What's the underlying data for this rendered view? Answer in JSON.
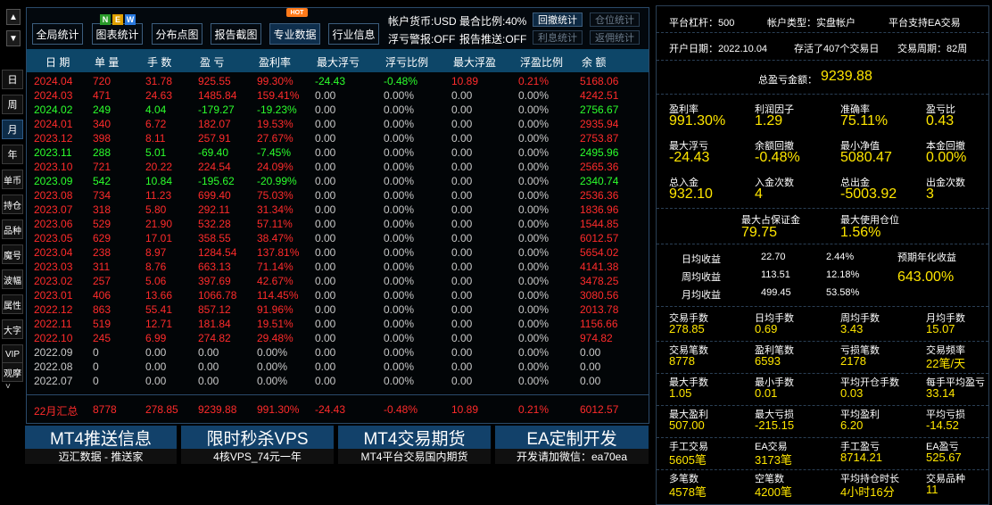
{
  "nav": {
    "up_arrow": "▲",
    "down_arrow": "▼",
    "left_tabs": [
      "日",
      "周",
      "月",
      "年",
      "单币",
      "持仓",
      "品种",
      "魔号",
      "波幅",
      "属性",
      "大字",
      "VIP",
      "观摩"
    ],
    "more_chevron": "˅"
  },
  "toolbar": {
    "buttons": [
      "全局统计",
      "图表统计",
      "分布点图",
      "报告截图",
      "专业数据",
      "行业信息"
    ],
    "new_badge": [
      "N",
      "E",
      "W"
    ],
    "hot_badge": "HOT",
    "account_currency": "帐户货币:USD",
    "max_ratio": "最合比例:40%",
    "floating_alert": "浮亏警报:OFF",
    "report_push": "报告推送:OFF",
    "small_buttons": [
      "回撤统计",
      "仓位统计",
      "利息统计",
      "返佣统计"
    ]
  },
  "table": {
    "headers": [
      "日 期",
      "单 量",
      "手 数",
      "盈 亏",
      "盈利率",
      "最大浮亏",
      "浮亏比例",
      "最大浮盈",
      "浮盈比例",
      "余 额"
    ],
    "rows": [
      {
        "date": "2024.04",
        "orders": "720",
        "lots": "31.78",
        "pnl": "925.55",
        "rate": "99.30%",
        "max_dd": "-24.43",
        "dd_ratio": "-0.48%",
        "max_fp": "10.89",
        "fp_ratio": "0.21%",
        "balance": "5168.06",
        "color": "red"
      },
      {
        "date": "2024.03",
        "orders": "471",
        "lots": "24.63",
        "pnl": "1485.84",
        "rate": "159.41%",
        "max_dd": "0.00",
        "dd_ratio": "0.00%",
        "max_fp": "0.00",
        "fp_ratio": "0.00%",
        "balance": "4242.51",
        "color": "red"
      },
      {
        "date": "2024.02",
        "orders": "249",
        "lots": "4.04",
        "pnl": "-179.27",
        "rate": "-19.23%",
        "max_dd": "0.00",
        "dd_ratio": "0.00%",
        "max_fp": "0.00",
        "fp_ratio": "0.00%",
        "balance": "2756.67",
        "color": "green"
      },
      {
        "date": "2024.01",
        "orders": "340",
        "lots": "6.72",
        "pnl": "182.07",
        "rate": "19.53%",
        "max_dd": "0.00",
        "dd_ratio": "0.00%",
        "max_fp": "0.00",
        "fp_ratio": "0.00%",
        "balance": "2935.94",
        "color": "red"
      },
      {
        "date": "2023.12",
        "orders": "398",
        "lots": "8.11",
        "pnl": "257.91",
        "rate": "27.67%",
        "max_dd": "0.00",
        "dd_ratio": "0.00%",
        "max_fp": "0.00",
        "fp_ratio": "0.00%",
        "balance": "2753.87",
        "color": "red"
      },
      {
        "date": "2023.11",
        "orders": "288",
        "lots": "5.01",
        "pnl": "-69.40",
        "rate": "-7.45%",
        "max_dd": "0.00",
        "dd_ratio": "0.00%",
        "max_fp": "0.00",
        "fp_ratio": "0.00%",
        "balance": "2495.96",
        "color": "green"
      },
      {
        "date": "2023.10",
        "orders": "721",
        "lots": "20.22",
        "pnl": "224.54",
        "rate": "24.09%",
        "max_dd": "0.00",
        "dd_ratio": "0.00%",
        "max_fp": "0.00",
        "fp_ratio": "0.00%",
        "balance": "2565.36",
        "color": "red"
      },
      {
        "date": "2023.09",
        "orders": "542",
        "lots": "10.84",
        "pnl": "-195.62",
        "rate": "-20.99%",
        "max_dd": "0.00",
        "dd_ratio": "0.00%",
        "max_fp": "0.00",
        "fp_ratio": "0.00%",
        "balance": "2340.74",
        "color": "green"
      },
      {
        "date": "2023.08",
        "orders": "734",
        "lots": "11.23",
        "pnl": "699.40",
        "rate": "75.03%",
        "max_dd": "0.00",
        "dd_ratio": "0.00%",
        "max_fp": "0.00",
        "fp_ratio": "0.00%",
        "balance": "2536.36",
        "color": "red"
      },
      {
        "date": "2023.07",
        "orders": "318",
        "lots": "5.80",
        "pnl": "292.11",
        "rate": "31.34%",
        "max_dd": "0.00",
        "dd_ratio": "0.00%",
        "max_fp": "0.00",
        "fp_ratio": "0.00%",
        "balance": "1836.96",
        "color": "red"
      },
      {
        "date": "2023.06",
        "orders": "529",
        "lots": "21.90",
        "pnl": "532.28",
        "rate": "57.11%",
        "max_dd": "0.00",
        "dd_ratio": "0.00%",
        "max_fp": "0.00",
        "fp_ratio": "0.00%",
        "balance": "1544.85",
        "color": "red"
      },
      {
        "date": "2023.05",
        "orders": "629",
        "lots": "17.01",
        "pnl": "358.55",
        "rate": "38.47%",
        "max_dd": "0.00",
        "dd_ratio": "0.00%",
        "max_fp": "0.00",
        "fp_ratio": "0.00%",
        "balance": "6012.57",
        "color": "red"
      },
      {
        "date": "2023.04",
        "orders": "238",
        "lots": "8.97",
        "pnl": "1284.54",
        "rate": "137.81%",
        "max_dd": "0.00",
        "dd_ratio": "0.00%",
        "max_fp": "0.00",
        "fp_ratio": "0.00%",
        "balance": "5654.02",
        "color": "red"
      },
      {
        "date": "2023.03",
        "orders": "311",
        "lots": "8.76",
        "pnl": "663.13",
        "rate": "71.14%",
        "max_dd": "0.00",
        "dd_ratio": "0.00%",
        "max_fp": "0.00",
        "fp_ratio": "0.00%",
        "balance": "4141.38",
        "color": "red"
      },
      {
        "date": "2023.02",
        "orders": "257",
        "lots": "5.06",
        "pnl": "397.69",
        "rate": "42.67%",
        "max_dd": "0.00",
        "dd_ratio": "0.00%",
        "max_fp": "0.00",
        "fp_ratio": "0.00%",
        "balance": "3478.25",
        "color": "red"
      },
      {
        "date": "2023.01",
        "orders": "406",
        "lots": "13.66",
        "pnl": "1066.78",
        "rate": "114.45%",
        "max_dd": "0.00",
        "dd_ratio": "0.00%",
        "max_fp": "0.00",
        "fp_ratio": "0.00%",
        "balance": "3080.56",
        "color": "red"
      },
      {
        "date": "2022.12",
        "orders": "863",
        "lots": "55.41",
        "pnl": "857.12",
        "rate": "91.96%",
        "max_dd": "0.00",
        "dd_ratio": "0.00%",
        "max_fp": "0.00",
        "fp_ratio": "0.00%",
        "balance": "2013.78",
        "color": "red"
      },
      {
        "date": "2022.11",
        "orders": "519",
        "lots": "12.71",
        "pnl": "181.84",
        "rate": "19.51%",
        "max_dd": "0.00",
        "dd_ratio": "0.00%",
        "max_fp": "0.00",
        "fp_ratio": "0.00%",
        "balance": "1156.66",
        "color": "red"
      },
      {
        "date": "2022.10",
        "orders": "245",
        "lots": "6.99",
        "pnl": "274.82",
        "rate": "29.48%",
        "max_dd": "0.00",
        "dd_ratio": "0.00%",
        "max_fp": "0.00",
        "fp_ratio": "0.00%",
        "balance": "974.82",
        "color": "red"
      },
      {
        "date": "2022.09",
        "orders": "0",
        "lots": "0.00",
        "pnl": "0.00",
        "rate": "0.00%",
        "max_dd": "0.00",
        "dd_ratio": "0.00%",
        "max_fp": "0.00",
        "fp_ratio": "0.00%",
        "balance": "0.00",
        "color": "gray"
      },
      {
        "date": "2022.08",
        "orders": "0",
        "lots": "0.00",
        "pnl": "0.00",
        "rate": "0.00%",
        "max_dd": "0.00",
        "dd_ratio": "0.00%",
        "max_fp": "0.00",
        "fp_ratio": "0.00%",
        "balance": "0.00",
        "color": "gray"
      },
      {
        "date": "2022.07",
        "orders": "0",
        "lots": "0.00",
        "pnl": "0.00",
        "rate": "0.00%",
        "max_dd": "0.00",
        "dd_ratio": "0.00%",
        "max_fp": "0.00",
        "fp_ratio": "0.00%",
        "balance": "0.00",
        "color": "gray"
      }
    ],
    "summary": {
      "date": "22月汇总",
      "orders": "8778",
      "lots": "278.85",
      "pnl": "9239.88",
      "rate": "991.30%",
      "max_dd": "-24.43",
      "dd_ratio": "-0.48%",
      "max_fp": "10.89",
      "fp_ratio": "0.21%",
      "balance": "6012.57"
    }
  },
  "ads": [
    {
      "title": "MT4推送信息",
      "subtitle": "迈汇数据 - 推送家"
    },
    {
      "title": "限时秒杀VPS",
      "subtitle": "4核VPS_74元一年"
    },
    {
      "title": "MT4交易期货",
      "subtitle": "MT4平台交易国内期货"
    },
    {
      "title": "EA定制开发",
      "subtitle": "开发请加微信：ea70ea"
    }
  ],
  "stats": {
    "platform_leverage": "平台杠杆：500",
    "account_type": "帐户类型：实盘帐户",
    "ea_support": "平台支持EA交易",
    "open_date": "开户日期：2022.10.04",
    "days_alive": "存活了407个交易日",
    "trade_period": "交易周期：82周",
    "total_pnl_label": "总盈亏金额：",
    "total_pnl_value": "9239.88",
    "g1": [
      {
        "label": "盈利率",
        "value": "991.30%"
      },
      {
        "label": "利润因子",
        "value": "1.29"
      },
      {
        "label": "准确率",
        "value": "75.11%"
      },
      {
        "label": "盈亏比",
        "value": "0.43"
      }
    ],
    "g2": [
      {
        "label": "最大浮亏",
        "value": "-24.43"
      },
      {
        "label": "余额回撤",
        "value": "-0.48%"
      },
      {
        "label": "最小净值",
        "value": "5080.47"
      },
      {
        "label": "本金回撤",
        "value": "0.00%"
      }
    ],
    "g3": [
      {
        "label": "总入金",
        "value": "932.10"
      },
      {
        "label": "入金次数",
        "value": "4"
      },
      {
        "label": "总出金",
        "value": "-5003.92"
      },
      {
        "label": "出金次数",
        "value": "3"
      }
    ],
    "g4": [
      {
        "label": "最大占保证金",
        "value": "79.75"
      },
      {
        "label": "最大使用仓位",
        "value": "1.56%"
      }
    ],
    "returns": [
      {
        "label": "日均收益",
        "amount": "22.70",
        "pct": "2.44%"
      },
      {
        "label": "周均收益",
        "amount": "113.51",
        "pct": "12.18%"
      },
      {
        "label": "月均收益",
        "amount": "499.45",
        "pct": "53.58%"
      }
    ],
    "annual_label": "预期年化收益",
    "annual_value": "643.00%",
    "g5": [
      {
        "label": "交易手数",
        "value": "278.85"
      },
      {
        "label": "日均手数",
        "value": "0.69"
      },
      {
        "label": "周均手数",
        "value": "3.43"
      },
      {
        "label": "月均手数",
        "value": "15.07"
      }
    ],
    "g6": [
      {
        "label": "交易笔数",
        "value": "8778"
      },
      {
        "label": "盈利笔数",
        "value": "6593"
      },
      {
        "label": "亏损笔数",
        "value": "2178"
      },
      {
        "label": "交易频率",
        "value": "22笔/天"
      }
    ],
    "g7": [
      {
        "label": "最大手数",
        "value": "1.05"
      },
      {
        "label": "最小手数",
        "value": "0.01"
      },
      {
        "label": "平均开仓手数",
        "value": "0.03"
      },
      {
        "label": "每手平均盈亏",
        "value": "33.14"
      }
    ],
    "g8": [
      {
        "label": "最大盈利",
        "value": "507.00"
      },
      {
        "label": "最大亏损",
        "value": "-215.15"
      },
      {
        "label": "平均盈利",
        "value": "6.20"
      },
      {
        "label": "平均亏损",
        "value": "-14.52"
      }
    ],
    "g9": [
      {
        "label": "手工交易",
        "value": "5605笔"
      },
      {
        "label": "EA交易",
        "value": "3173笔"
      },
      {
        "label": "手工盈亏",
        "value": "8714.21"
      },
      {
        "label": "EA盈亏",
        "value": "525.67"
      }
    ],
    "g10": [
      {
        "label": "多笔数",
        "value": "4578笔"
      },
      {
        "label": "空笔数",
        "value": "4200笔"
      },
      {
        "label": "平均持仓时长",
        "value": "4小时16分"
      },
      {
        "label": "交易品种",
        "value": "11"
      }
    ]
  },
  "colors": {
    "red": "#ff2b2b",
    "green": "#2cff2c",
    "gray": "#c8c8c8",
    "yellow": "#ffe600",
    "header_blue": "#0d4668",
    "ad_blue": "#12416a"
  }
}
